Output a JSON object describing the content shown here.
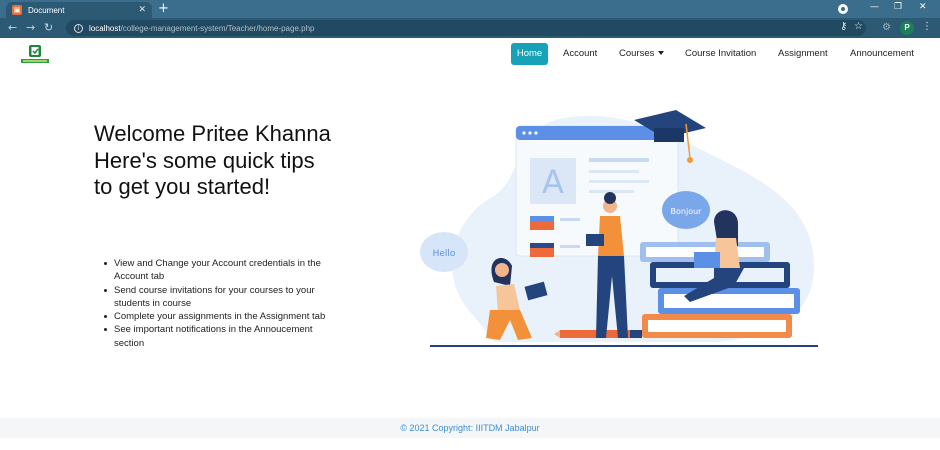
{
  "browser": {
    "tab_title": "Document",
    "favicon": "document-favicon",
    "url_host": "localhost",
    "url_path": "/college-management-system/Teacher/home-page.php",
    "profile_initial": "P"
  },
  "navbar": {
    "items": [
      {
        "label": "Home",
        "active": true
      },
      {
        "label": "Account"
      },
      {
        "label": "Courses",
        "dropdown": true
      },
      {
        "label": "Course Invitation"
      },
      {
        "label": "Assignment"
      },
      {
        "label": "Announcement"
      }
    ]
  },
  "main": {
    "welcome_line1": "Welcome Pritee Khanna",
    "welcome_line2": "Here's some quick tips to get you started!",
    "tips": [
      "View and Change your Account credentials in the Account tab",
      "Send course invitations for your courses to your students in course",
      "Complete your assignments in the Assignment tab",
      "See important notifications in the Annoucement section"
    ],
    "illustration": {
      "bubble_left": "Hello",
      "bubble_right": "Bonjour",
      "card_letter": "A"
    }
  },
  "footer": {
    "copyright": "© 2021 Copyright: IIITDM Jabalpur"
  },
  "colors": {
    "accent": "#17a2b8",
    "chrome": "#3b6e8c",
    "footer_text": "#3a8ed8"
  }
}
